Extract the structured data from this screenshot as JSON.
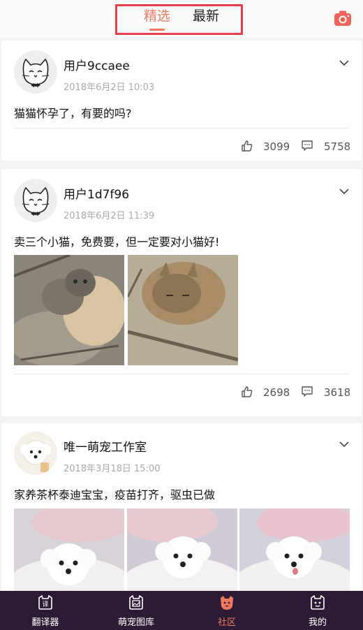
{
  "header": {
    "tabs": [
      {
        "label": "精选",
        "active": true
      },
      {
        "label": "最新",
        "active": false
      }
    ],
    "camera_icon": "camera-icon",
    "accent_color": "#ef7a5f",
    "highlight_color": "#e83d4a"
  },
  "posts": [
    {
      "username": "用户9ccaee",
      "time": "2018年6月2日 10:03",
      "text": "猫猫怀孕了，有要的吗?",
      "likes": "3099",
      "comments": "5758",
      "avatar": "cat-cartoon-avatar",
      "images": []
    },
    {
      "username": "用户1d7f96",
      "time": "2018年6月2日 11:39",
      "text": "卖三个小猫，免费要，但一定要对小猫好!",
      "likes": "2698",
      "comments": "3618",
      "avatar": "cat-cartoon-avatar",
      "images": [
        "kittens-photo",
        "tabby-cat-photo"
      ]
    },
    {
      "username": "唯一萌宠工作室",
      "time": "2018年3月18日 15:00",
      "text": "家养茶杯泰迪宝宝，疫苗打齐，驱虫已做",
      "avatar": "white-puppy-avatar",
      "images": [
        "white-puppy-photo-1",
        "white-puppy-photo-2",
        "white-puppy-photo-3"
      ]
    }
  ],
  "bottom_nav": [
    {
      "label": "翻译器",
      "icon": "translate-icon",
      "active": false
    },
    {
      "label": "萌宠图库",
      "icon": "gallery-icon",
      "active": false
    },
    {
      "label": "社区",
      "icon": "community-cat-icon",
      "active": true
    },
    {
      "label": "我的",
      "icon": "profile-icon",
      "active": false
    }
  ]
}
